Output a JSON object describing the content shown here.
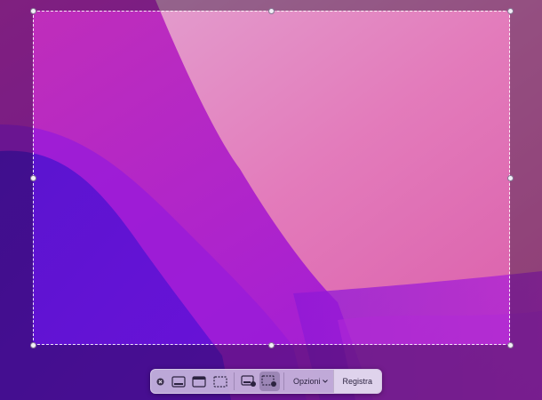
{
  "screenshot_toolbar": {
    "options_label": "Opzioni",
    "record_label": "Registra",
    "tools": [
      {
        "icon": "close-icon"
      },
      {
        "icon": "capture-screen-icon"
      },
      {
        "icon": "capture-window-icon"
      },
      {
        "icon": "capture-selection-icon"
      },
      {
        "icon": "record-screen-icon"
      },
      {
        "icon": "record-selection-icon",
        "active": true
      }
    ]
  },
  "colors": {
    "wallpaper_pink": "#e07ab8",
    "wallpaper_magenta": "#c23ad0",
    "wallpaper_purple": "#5a1fd6",
    "toolbar_bg": "#cdbee1"
  }
}
